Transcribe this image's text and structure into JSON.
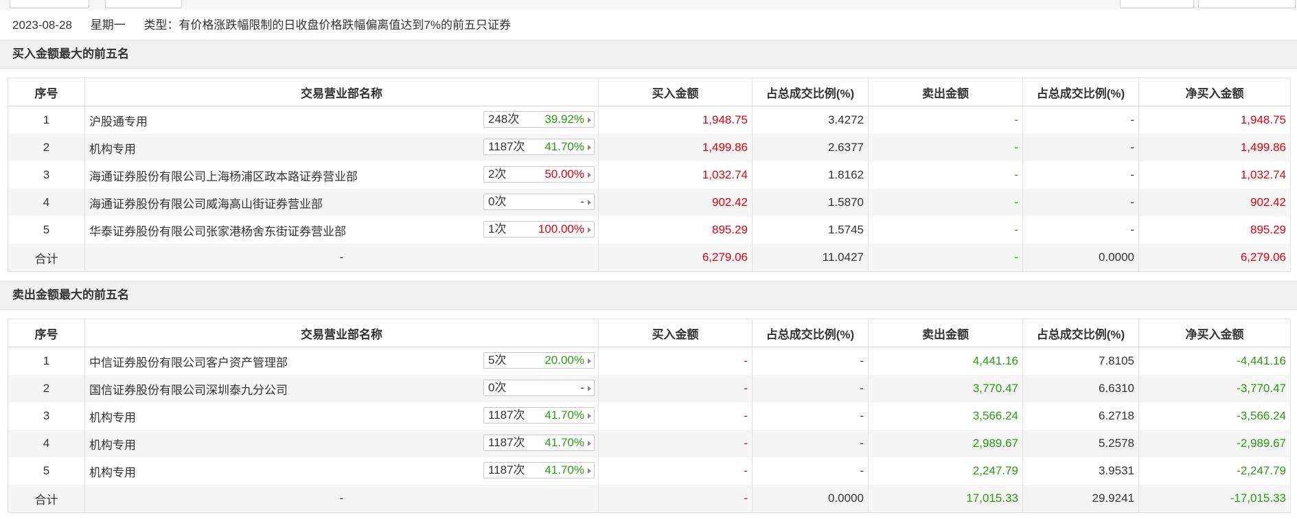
{
  "info": {
    "date": "2023-08-28",
    "weekday": "星期一",
    "type": "类型：有价格涨跌幅限制的日收盘价格跌幅偏离值达到7%的前五只证券"
  },
  "headers": [
    "序号",
    "交易营业部名称",
    "买入金额",
    "占总成交比例(%)",
    "卖出金额",
    "占总成交比例(%)",
    "净买入金额"
  ],
  "buy_section": {
    "title": "买入金额最大的前五名",
    "rows": [
      {
        "no": "1",
        "name": "沪股通专用",
        "count": "248次",
        "pct": "39.92%",
        "buy": "1,948.75",
        "buy_ratio": "3.4272",
        "sell": "-",
        "sell_ratio": "-",
        "net": "1,948.75"
      },
      {
        "no": "2",
        "name": "机构专用",
        "count": "1187次",
        "pct": "41.70%",
        "buy": "1,499.86",
        "buy_ratio": "2.6377",
        "sell": "-",
        "sell_ratio": "-",
        "net": "1,499.86"
      },
      {
        "no": "3",
        "name": "海通证券股份有限公司上海杨浦区政本路证券营业部",
        "count": "2次",
        "pct": "50.00%",
        "buy": "1,032.74",
        "buy_ratio": "1.8162",
        "sell": "-",
        "sell_ratio": "-",
        "net": "1,032.74"
      },
      {
        "no": "4",
        "name": "海通证券股份有限公司威海高山街证券营业部",
        "count": "0次",
        "pct": "-",
        "buy": "902.42",
        "buy_ratio": "1.5870",
        "sell": "-",
        "sell_ratio": "-",
        "net": "902.42"
      },
      {
        "no": "5",
        "name": "华泰证券股份有限公司张家港杨舍东街证券营业部",
        "count": "1次",
        "pct": "100.00%",
        "buy": "895.29",
        "buy_ratio": "1.5745",
        "sell": "-",
        "sell_ratio": "-",
        "net": "895.29"
      }
    ],
    "total": {
      "label": "合计",
      "name": "-",
      "buy": "6,279.06",
      "buy_ratio": "11.0427",
      "sell": "-",
      "sell_ratio": "0.0000",
      "net": "6,279.06"
    }
  },
  "sell_section": {
    "title": "卖出金额最大的前五名",
    "rows": [
      {
        "no": "1",
        "name": "中信证券股份有限公司客户资产管理部",
        "count": "5次",
        "pct": "20.00%",
        "buy": "-",
        "buy_ratio": "-",
        "sell": "4,441.16",
        "sell_ratio": "7.8105",
        "net": "-4,441.16"
      },
      {
        "no": "2",
        "name": "国信证券股份有限公司深圳泰九分公司",
        "count": "0次",
        "pct": "-",
        "buy": "-",
        "buy_ratio": "-",
        "sell": "3,770.47",
        "sell_ratio": "6.6310",
        "net": "-3,770.47"
      },
      {
        "no": "3",
        "name": "机构专用",
        "count": "1187次",
        "pct": "41.70%",
        "buy": "-",
        "buy_ratio": "-",
        "sell": "3,566.24",
        "sell_ratio": "6.2718",
        "net": "-3,566.24"
      },
      {
        "no": "4",
        "name": "机构专用",
        "count": "1187次",
        "pct": "41.70%",
        "buy": "-",
        "buy_ratio": "-",
        "sell": "2,989.67",
        "sell_ratio": "5.2578",
        "net": "-2,989.67"
      },
      {
        "no": "5",
        "name": "机构专用",
        "count": "1187次",
        "pct": "41.70%",
        "buy": "-",
        "buy_ratio": "-",
        "sell": "2,247.79",
        "sell_ratio": "3.9531",
        "net": "-2,247.79"
      }
    ],
    "total": {
      "label": "合计",
      "name": "-",
      "buy": "-",
      "buy_ratio": "0.0000",
      "sell": "17,015.33",
      "sell_ratio": "29.9241",
      "net": "-17,015.33"
    }
  },
  "colors": {
    "up": "#e4000a",
    "down": "#2c9b13",
    "text": "#333333"
  }
}
